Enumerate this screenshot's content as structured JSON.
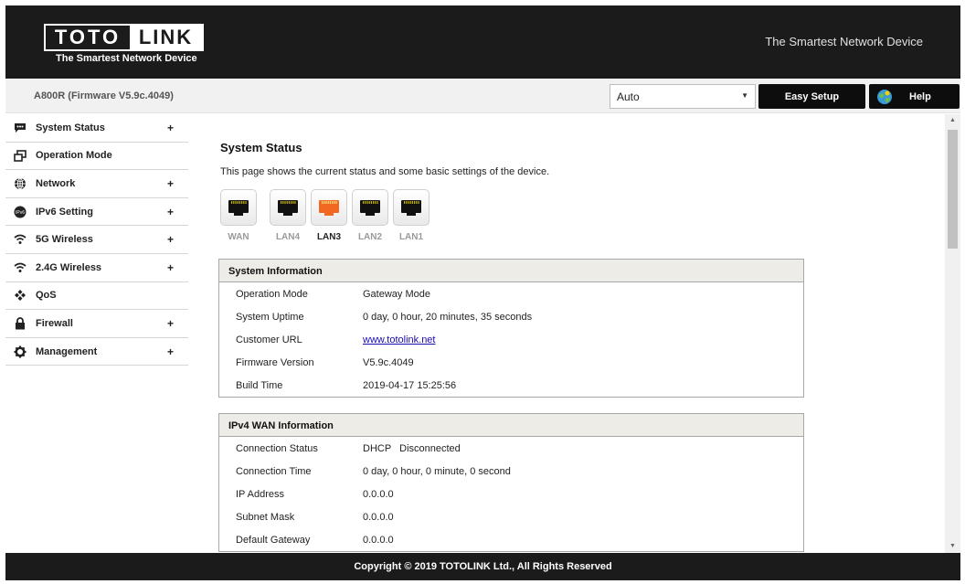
{
  "header": {
    "logo_left": "TOTO",
    "logo_right": "LINK",
    "logo_tagline": "The Smartest Network Device",
    "tagline": "The Smartest Network Device"
  },
  "subbar": {
    "model": "A800R (Firmware V5.9c.4049)",
    "language_selected": "Auto",
    "easy_setup_label": "Easy Setup",
    "help_label": "Help"
  },
  "sidebar": {
    "items": [
      {
        "label": "System Status",
        "icon": "chat-bubble-icon",
        "expandable": true
      },
      {
        "label": "Operation Mode",
        "icon": "windows-icon",
        "expandable": false
      },
      {
        "label": "Network",
        "icon": "globe-icon",
        "expandable": true
      },
      {
        "label": "IPv6 Setting",
        "icon": "ipv6-icon",
        "expandable": true
      },
      {
        "label": "5G Wireless",
        "icon": "wifi-icon",
        "expandable": true
      },
      {
        "label": "2.4G Wireless",
        "icon": "wifi-icon",
        "expandable": true
      },
      {
        "label": "QoS",
        "icon": "qos-icon",
        "expandable": false
      },
      {
        "label": "Firewall",
        "icon": "lock-icon",
        "expandable": true
      },
      {
        "label": "Management",
        "icon": "gear-icon",
        "expandable": true
      }
    ],
    "plus_symbol": "+"
  },
  "main": {
    "title": "System Status",
    "description": "This page shows the current status and some basic settings of the device.",
    "ports": [
      {
        "label": "WAN",
        "active": false
      },
      {
        "label": "LAN4",
        "active": false
      },
      {
        "label": "LAN3",
        "active": true
      },
      {
        "label": "LAN2",
        "active": false
      },
      {
        "label": "LAN1",
        "active": false
      }
    ],
    "system_info": {
      "title": "System Information",
      "rows": [
        {
          "label": "Operation Mode",
          "value": "Gateway Mode"
        },
        {
          "label": "System Uptime",
          "value": "0 day, 0 hour, 20 minutes, 35 seconds"
        },
        {
          "label": "Customer URL",
          "value": "www.totolink.net"
        },
        {
          "label": "Firmware Version",
          "value": "V5.9c.4049"
        },
        {
          "label": "Build Time",
          "value": "2019-04-17 15:25:56"
        }
      ]
    },
    "wan_info": {
      "title": "IPv4 WAN Information",
      "rows": [
        {
          "label": "Connection Status",
          "value": "DHCP   Disconnected"
        },
        {
          "label": "Connection Time",
          "value": "0 day, 0 hour, 0 minute, 0 second"
        },
        {
          "label": "IP Address",
          "value": "0.0.0.0"
        },
        {
          "label": "Subnet Mask",
          "value": "0.0.0.0"
        },
        {
          "label": "Default Gateway",
          "value": "0.0.0.0"
        }
      ]
    }
  },
  "footer": {
    "copyright": "Copyright © 2019 TOTOLINK Ltd., All Rights Reserved"
  },
  "colors": {
    "header_bg": "#1b1b1b",
    "active_port": "#f26722",
    "panel_header_bg": "#eeece6"
  }
}
